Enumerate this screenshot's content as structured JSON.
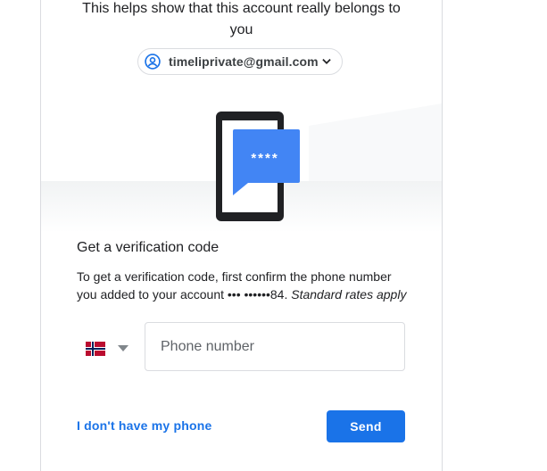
{
  "intro": {
    "line1": "This helps show that this account really belongs to",
    "line2": "you"
  },
  "account": {
    "email": "timeliprivate@gmail.com",
    "avatar_icon": "account-circle-icon",
    "dropdown_icon": "chevron-down-icon"
  },
  "illustration": {
    "bubble_text": "****",
    "bubble_color": "#4285f4"
  },
  "verification": {
    "heading": "Get a verification code",
    "desc_line1": "To get a verification code, first confirm the phone number",
    "desc_line2_prefix": "you added to your account ••• ••••••84.",
    "desc_line2_italic": "Standard rates apply"
  },
  "phone": {
    "country_flag": "norway-flag-icon",
    "placeholder": "Phone number",
    "value": ""
  },
  "actions": {
    "no_phone_label": "I don't have my phone",
    "send_label": "Send"
  },
  "colors": {
    "accent": "#1a73e8",
    "text": "#202124",
    "border": "#dadce0"
  }
}
